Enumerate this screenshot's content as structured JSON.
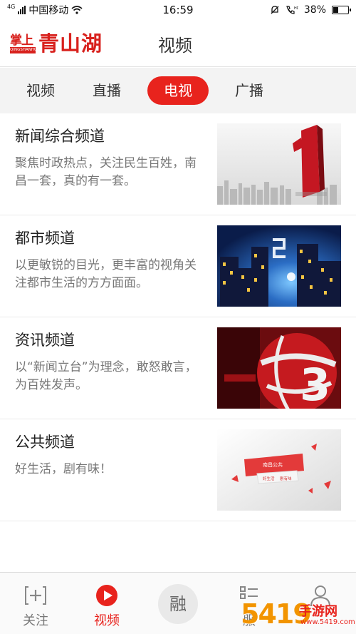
{
  "status_bar": {
    "network": "4G",
    "carrier": "中国移动",
    "time": "16:59",
    "battery": "38%",
    "battery_level": 0.38,
    "icons": [
      "signal-icon",
      "wifi-icon",
      "alarm-off-icon",
      "call-icon",
      "battery-icon"
    ]
  },
  "header": {
    "logo_small": "掌上",
    "logo_big": "青山湖",
    "logo_pinyin": "QINGSHANHU",
    "title": "视频"
  },
  "tabs": [
    {
      "label": "视频",
      "active": false
    },
    {
      "label": "直播",
      "active": false
    },
    {
      "label": "电视",
      "active": true
    },
    {
      "label": "广播",
      "active": false
    }
  ],
  "channels": [
    {
      "name": "新闻综合频道",
      "desc": "聚焦时政热点，关注民生百姓，南昌一套，真的有一套。",
      "thumb": "channel-1-logo"
    },
    {
      "name": "都市频道",
      "desc": "以更敏锐的目光，更丰富的视角关注都市生活的方方面面。",
      "thumb": "channel-2-city-night"
    },
    {
      "name": "资讯频道",
      "desc": "以“新闻立台”为理念，敢怒敢言，为百姓发声。",
      "thumb": "channel-3-globe"
    },
    {
      "name": "公共频道",
      "desc": "好生活，剧有味！",
      "thumb": "channel-4-public",
      "thumb_text": {
        "title": "南昌公共",
        "slogan_a": "好生活",
        "slogan_b": "剧有味"
      }
    }
  ],
  "bottom_nav": [
    {
      "label": "关注",
      "icon": "follow-icon",
      "active": false
    },
    {
      "label": "视频",
      "icon": "play-icon",
      "active": true
    },
    {
      "label": "融",
      "icon": "rong-icon",
      "active": false
    },
    {
      "label": "服",
      "icon": "service-icon",
      "active": false
    },
    {
      "label": "",
      "icon": "user-icon",
      "active": false
    }
  ],
  "watermark": {
    "number": "5419",
    "site": "手游网",
    "url": "www.5419.com"
  },
  "colors": {
    "accent": "#e8231d",
    "logo": "#d8211d",
    "tab_bg": "#f3f3f3",
    "watermark_orange": "#f29400"
  }
}
